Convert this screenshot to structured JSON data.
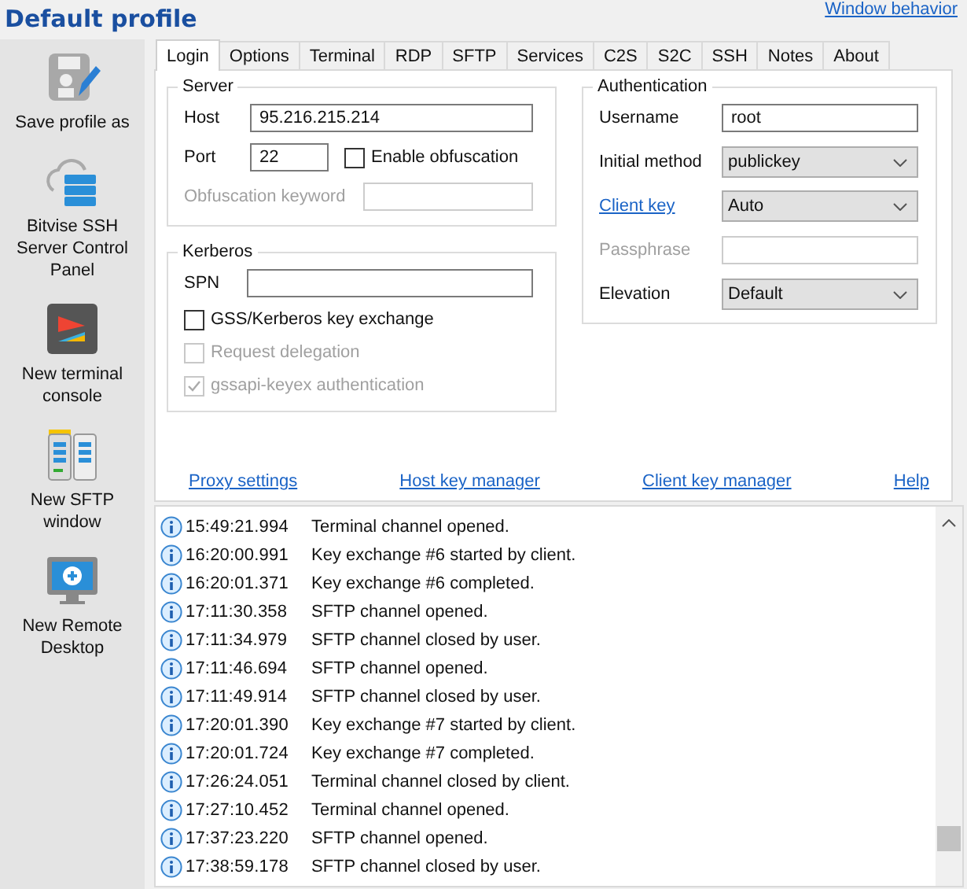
{
  "header": {
    "title": "Default profile",
    "link": "Window behavior"
  },
  "sidebar": [
    {
      "kind": "save",
      "label": "Save profile as"
    },
    {
      "kind": "server",
      "label": "Bitvise SSH Server Control Panel"
    },
    {
      "kind": "terminal",
      "label": "New terminal console"
    },
    {
      "kind": "sftp",
      "label": "New SFTP window"
    },
    {
      "kind": "remote",
      "label": "New Remote Desktop"
    }
  ],
  "tabs": [
    {
      "label": "Login",
      "selected": true
    },
    {
      "label": "Options",
      "selected": false
    },
    {
      "label": "Terminal",
      "selected": false
    },
    {
      "label": "RDP",
      "selected": false
    },
    {
      "label": "SFTP",
      "selected": false
    },
    {
      "label": "Services",
      "selected": false
    },
    {
      "label": "C2S",
      "selected": false
    },
    {
      "label": "S2C",
      "selected": false
    },
    {
      "label": "SSH",
      "selected": false
    },
    {
      "label": "Notes",
      "selected": false
    },
    {
      "label": "About",
      "selected": false
    }
  ],
  "server": {
    "title": "Server",
    "host": {
      "label": "Host",
      "value": "95.216.215.214"
    },
    "port": {
      "label": "Port",
      "value": "22"
    },
    "obfuscation": {
      "label": "Enable obfuscation",
      "checked": false
    },
    "keyword": {
      "label": "Obfuscation keyword",
      "disabled": true
    }
  },
  "kerberos": {
    "title": "Kerberos",
    "spn": {
      "label": "SPN"
    },
    "options": [
      {
        "label": "GSS/Kerberos key exchange",
        "checked": false,
        "disabled": false
      },
      {
        "label": "Request delegation",
        "checked": false,
        "disabled": true
      },
      {
        "label": "gssapi-keyex authentication",
        "checked": true,
        "disabled": true
      }
    ]
  },
  "authentication": {
    "title": "Authentication",
    "fields": [
      {
        "kind": "input",
        "label": "Username",
        "value": "root",
        "disabled": false
      },
      {
        "kind": "select",
        "label": "Initial method",
        "value": "publickey"
      },
      {
        "kind": "select",
        "label": "Client key",
        "value": "Auto",
        "label_link": true
      },
      {
        "kind": "input",
        "label": "Passphrase",
        "disabled": true
      },
      {
        "kind": "select",
        "label": "Elevation",
        "value": "Default"
      }
    ]
  },
  "links": [
    "Proxy settings",
    "Host key manager",
    "Client key manager",
    "Help"
  ],
  "log": [
    {
      "time": "15:49:21.994",
      "message": "Terminal channel opened."
    },
    {
      "time": "16:20:00.991",
      "message": "Key exchange #6 started by client."
    },
    {
      "time": "16:20:01.371",
      "message": "Key exchange #6 completed."
    },
    {
      "time": "17:11:30.358",
      "message": "SFTP channel opened."
    },
    {
      "time": "17:11:34.979",
      "message": "SFTP channel closed by user."
    },
    {
      "time": "17:11:46.694",
      "message": "SFTP channel opened."
    },
    {
      "time": "17:11:49.914",
      "message": "SFTP channel closed by user."
    },
    {
      "time": "17:20:01.390",
      "message": "Key exchange #7 started by client."
    },
    {
      "time": "17:20:01.724",
      "message": "Key exchange #7 completed."
    },
    {
      "time": "17:26:24.051",
      "message": "Terminal channel closed by client."
    },
    {
      "time": "17:27:10.452",
      "message": "Terminal channel opened."
    },
    {
      "time": "17:37:23.220",
      "message": "SFTP channel opened."
    },
    {
      "time": "17:38:59.178",
      "message": "SFTP channel closed by user."
    }
  ]
}
